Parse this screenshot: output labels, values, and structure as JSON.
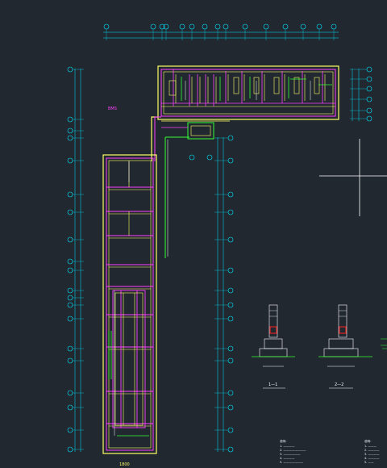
{
  "colors": {
    "background": "#212830",
    "axis": "#00e5ff",
    "wall_magenta": "#ff40ff",
    "wall_yellow": "#ffff66",
    "pipe_green": "#33ff33",
    "detail_red": "#ff2020",
    "white": "#ffffff"
  },
  "drawing": {
    "pink_label": "BMS",
    "bottom_label": "1800"
  },
  "sections": [
    {
      "id": "1-1",
      "label": "1—1"
    },
    {
      "id": "2-2",
      "label": "2—2"
    }
  ],
  "notes": {
    "title": "说明：",
    "lines": [
      "1. ————",
      "2. ————————",
      "3. ——————",
      "4. ————",
      "5. ———————"
    ]
  },
  "notes_right": {
    "title": "说明：",
    "lines": [
      "1. ———",
      "2. ————",
      "3. ————",
      "4. ————",
      "5. ——"
    ]
  }
}
